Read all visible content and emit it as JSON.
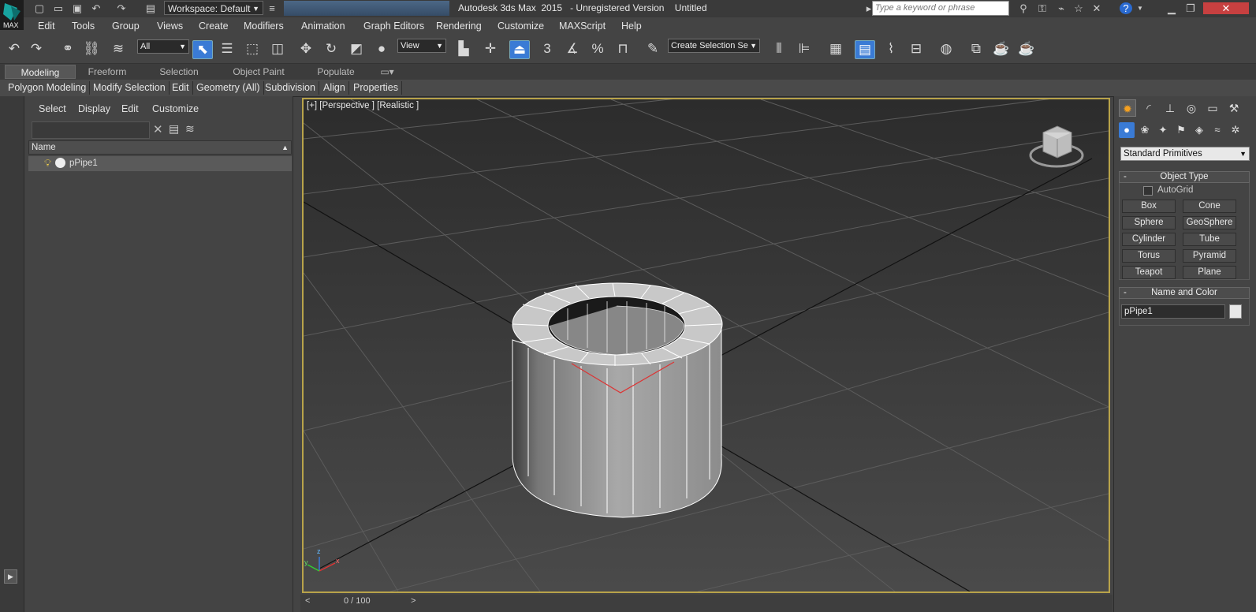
{
  "titlebar": {
    "app_badge": "MAX",
    "workspace": "Workspace: Default",
    "title": "Autodesk 3ds Max  2015   - Unregistered Version    Untitled",
    "search_placeholder": "Type a keyword or phrase"
  },
  "menubar": [
    "Edit",
    "Tools",
    "Group",
    "Views",
    "Create",
    "Modifiers",
    "Animation",
    "Graph Editors",
    "Rendering",
    "Customize",
    "MAXScript",
    "Help"
  ],
  "toolbar": {
    "selection_filter": "All",
    "ref_coord": "View",
    "snap_label": "3",
    "named_selection": "Create Selection Se"
  },
  "ribbon": {
    "tabs": [
      "Modeling",
      "Freeform",
      "Selection",
      "Object Paint",
      "Populate"
    ],
    "panels": [
      "Polygon Modeling",
      "Modify Selection",
      "Edit",
      "Geometry (All)",
      "Subdivision",
      "Align",
      "Properties"
    ]
  },
  "explorer": {
    "menu": [
      "Select",
      "Display",
      "Edit",
      "Customize"
    ],
    "column": "Name",
    "rows": [
      "pPipe1"
    ]
  },
  "viewport": {
    "label": "[+] [Perspective ] [Realistic ]",
    "axis_z": "z",
    "axis_x": "x",
    "axis_y": "y"
  },
  "timeline": {
    "position": "0 / 100"
  },
  "command_panel": {
    "category_dropdown": "Standard Primitives",
    "object_type_header": "Object Type",
    "autogrid": "AutoGrid",
    "buttons": [
      "Box",
      "Cone",
      "Sphere",
      "GeoSphere",
      "Cylinder",
      "Tube",
      "Torus",
      "Pyramid",
      "Teapot",
      "Plane"
    ],
    "name_color_header": "Name and Color",
    "object_name": "pPipe1"
  }
}
